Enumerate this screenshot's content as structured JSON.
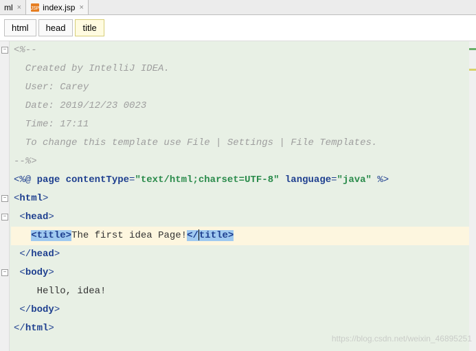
{
  "tabs": [
    {
      "label": "ml",
      "active": false
    },
    {
      "label": "index.jsp",
      "active": true
    }
  ],
  "breadcrumb": [
    {
      "label": "html",
      "active": false
    },
    {
      "label": "head",
      "active": false
    },
    {
      "label": "title",
      "active": true
    }
  ],
  "code": {
    "comment_open": "<%--",
    "c1": "  Created by IntelliJ IDEA.",
    "c2": "  User: Carey",
    "c3": "  Date: 2019/12/23 0023",
    "c4": "  Time: 17:11",
    "c5": "  To change this template use File | Settings | File Templates.",
    "comment_close": "--%>",
    "directive": {
      "open": "<%@ ",
      "kw": "page",
      "sp1": " ",
      "a1": "contentType",
      "eq": "=",
      "q": "\"",
      "v1": "text/html;charset=UTF-8",
      "sp2": " ",
      "a2": "language",
      "v2": "java",
      "close": " %>"
    },
    "html_open": "html",
    "head_open": "head",
    "title_tag": "title",
    "title_text": "The first idea Page!",
    "head_close": "head",
    "body_open": "body",
    "body_text": "    Hello, idea!",
    "body_close": "body",
    "html_close": "html",
    "lt": "<",
    "gt": ">",
    "lts": "</",
    "ind1": " ",
    "ind2": "   "
  },
  "watermark": "https://blog.csdn.net/weixin_46895251"
}
